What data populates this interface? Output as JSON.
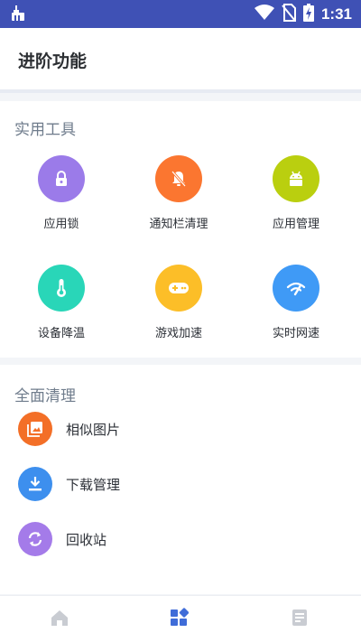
{
  "statusbar": {
    "time": "1:31"
  },
  "header": {
    "title": "进阶功能"
  },
  "tools": {
    "title": "实用工具",
    "items": [
      {
        "label": "应用锁",
        "color": "#9b7be9",
        "icon": "lock-icon"
      },
      {
        "label": "通知栏清理",
        "color": "#fb7630",
        "icon": "bell-off-icon"
      },
      {
        "label": "应用管理",
        "color": "#bacf0f",
        "icon": "android-icon"
      },
      {
        "label": "设备降温",
        "color": "#29d6b8",
        "icon": "thermometer-icon"
      },
      {
        "label": "游戏加速",
        "color": "#fcbe28",
        "icon": "gamepad-icon"
      },
      {
        "label": "实时网速",
        "color": "#3f9af6",
        "icon": "wifi-speed-icon"
      }
    ]
  },
  "clean": {
    "title": "全面清理",
    "items": [
      {
        "label": "相似图片",
        "color": "#f36f27",
        "icon": "images-icon"
      },
      {
        "label": "下载管理",
        "color": "#3d8fee",
        "icon": "download-icon"
      },
      {
        "label": "回收站",
        "color": "#a47be9",
        "icon": "recycle-icon"
      }
    ]
  },
  "bottom_nav": {
    "active_color": "#3f6cd8",
    "inactive_color": "#c9ccd2",
    "items": [
      {
        "icon": "home-icon",
        "active": false
      },
      {
        "icon": "grid-icon",
        "active": true
      },
      {
        "icon": "list-icon",
        "active": false
      }
    ]
  }
}
